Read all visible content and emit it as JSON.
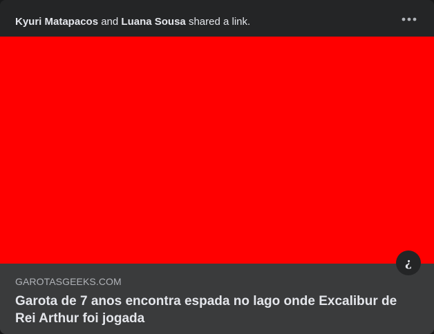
{
  "post": {
    "actor_1": "Kyuri Matapacos",
    "conjunction": "and",
    "actor_2": "Luana Sousa",
    "action": "shared a link."
  },
  "link_preview": {
    "image_color": "#ff0000",
    "domain": "GAROTASGEEKS.COM",
    "title": "Garota de 7 anos encontra espada no lago onde Excalibur de Rei Arthur foi jogada",
    "info_glyph": "¿"
  },
  "icons": {
    "more": "more-horizontal-icon",
    "info": "info-icon"
  }
}
